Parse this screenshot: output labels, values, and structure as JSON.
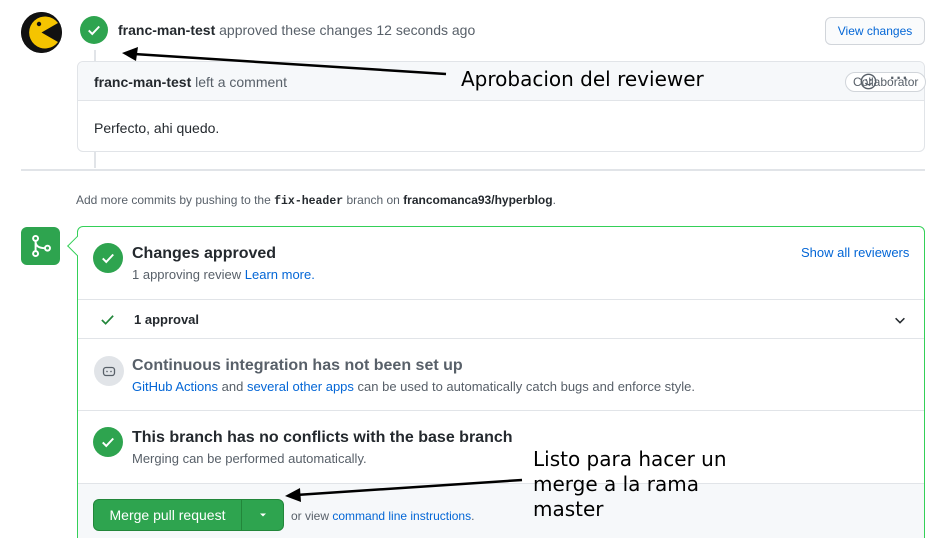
{
  "review": {
    "author": "franc-man-test",
    "action": "approved these changes",
    "time": "12 seconds ago",
    "view_changes_label": "View changes"
  },
  "comment": {
    "author": "franc-man-test",
    "action": "left a comment",
    "role_badge": "Collaborator",
    "body": "Perfecto, ahi quedo."
  },
  "push_hint": {
    "prefix": "Add more commits by pushing to the",
    "branch": "fix-header",
    "middle": "branch on",
    "repo": "francomanca93/hyperblog",
    "suffix": "."
  },
  "merge_box": {
    "approved_title": "Changes approved",
    "approved_sub": "1 approving review",
    "learn_more": "Learn more.",
    "show_all_reviewers": "Show all reviewers",
    "approval_count": "1 approval",
    "ci_title": "Continuous integration has not been set up",
    "ci_link1": "GitHub Actions",
    "ci_and": "and",
    "ci_link2": "several other apps",
    "ci_rest": "can be used to automatically catch bugs and enforce style.",
    "conflict_title": "This branch has no conflicts with the base branch",
    "conflict_sub": "Merging can be performed automatically.",
    "merge_button": "Merge pull request",
    "or_view": "or view",
    "cli_link": "command line instructions",
    "cli_suffix": "."
  },
  "annotations": {
    "reviewer": "Aprobacion del reviewer",
    "merge_line1": "Listo para hacer un",
    "merge_line2": "merge a la rama",
    "merge_line3": "master"
  },
  "colors": {
    "success_green": "#2ea44f",
    "link_blue": "#0366d6",
    "border_green": "#34d058"
  }
}
